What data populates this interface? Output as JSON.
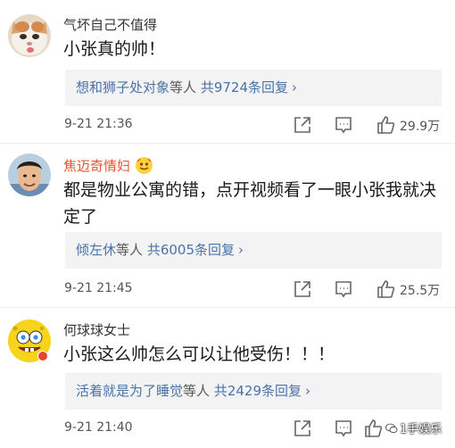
{
  "comments": [
    {
      "username": "气坏自己不值得",
      "text": "小张真的帅！",
      "reply_users": "想和狮子处对象",
      "reply_mid": "等人",
      "reply_count": "共9724条回复",
      "time": "9-21 21:36",
      "likes": "29.9万"
    },
    {
      "username": "焦迈奇情妇",
      "text": "都是物业公寓的错，点开视频看了一眼小张我就决定了",
      "reply_users": "倾左休",
      "reply_mid": "等人",
      "reply_count": "共6005条回复",
      "time": "9-21 21:45",
      "likes": "25.5万"
    },
    {
      "username": "何球球女士",
      "text": "小张这么帅怎么可以让他受伤！！！",
      "reply_users": "活着就是为了睡觉",
      "reply_mid": "等人",
      "reply_count": "共2429条回复",
      "time": "9-21 21:40",
      "likes": ""
    }
  ],
  "watermark": "1手娱乐",
  "colors": {
    "link": "#4a73a8",
    "vip_username": "#e8522d",
    "reply_bg": "#f3f3f3"
  },
  "icons": {
    "share": "share-icon",
    "comment": "comment-icon",
    "like": "thumbs-up-icon",
    "vip": "vip-face-icon"
  }
}
